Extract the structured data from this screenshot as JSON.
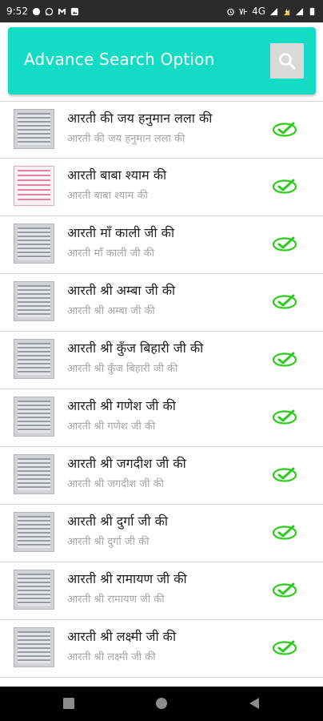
{
  "status_bar": {
    "time": "9:52",
    "network": "4G"
  },
  "header": {
    "title": "Advance Search Option",
    "color": "#14dcc4"
  },
  "items": [
    {
      "title": "आरती की जय हनुमान लला की",
      "subtitle": "आरती की जय हनुमान लला की",
      "icon": "check-circle-icon"
    },
    {
      "title": "आरती बाबा श्याम की",
      "subtitle": "आरती बाबा श्याम की",
      "icon": "check-circle-icon"
    },
    {
      "title": "आरती माँ काली जी की",
      "subtitle": "आरती माँ काली जी की",
      "icon": "check-circle-icon"
    },
    {
      "title": "आरती श्री अम्बा जी की",
      "subtitle": "आरती श्री अम्बा जी की",
      "icon": "check-circle-icon"
    },
    {
      "title": "आरती श्री कुँज बिहारी जी की",
      "subtitle": "आरती श्री कुँज बिहारी जी की",
      "icon": "check-circle-icon"
    },
    {
      "title": "आरती श्री गणेश जी की",
      "subtitle": "आरती श्री गणेश जी की",
      "icon": "check-circle-icon"
    },
    {
      "title": "आरती श्री जगदीश जी की",
      "subtitle": "आरती श्री जगदीश जी की",
      "icon": "check-circle-icon"
    },
    {
      "title": "आरती श्री दुर्गा जी की",
      "subtitle": "आरती श्री दुर्गा जी की",
      "icon": "check-circle-icon"
    },
    {
      "title": "आरती श्री रामायण जी की",
      "subtitle": "आरती श्री रामायण जी की",
      "icon": "check-circle-icon"
    },
    {
      "title": "आरती श्री लक्ष्मी जी की",
      "subtitle": "आरती श्री लक्ष्मी जी की",
      "icon": "check-circle-icon"
    }
  ],
  "colors": {
    "check": "#2ecc1a"
  },
  "nav_bar": {
    "buttons": [
      "recents-icon",
      "home-icon",
      "back-icon"
    ]
  }
}
